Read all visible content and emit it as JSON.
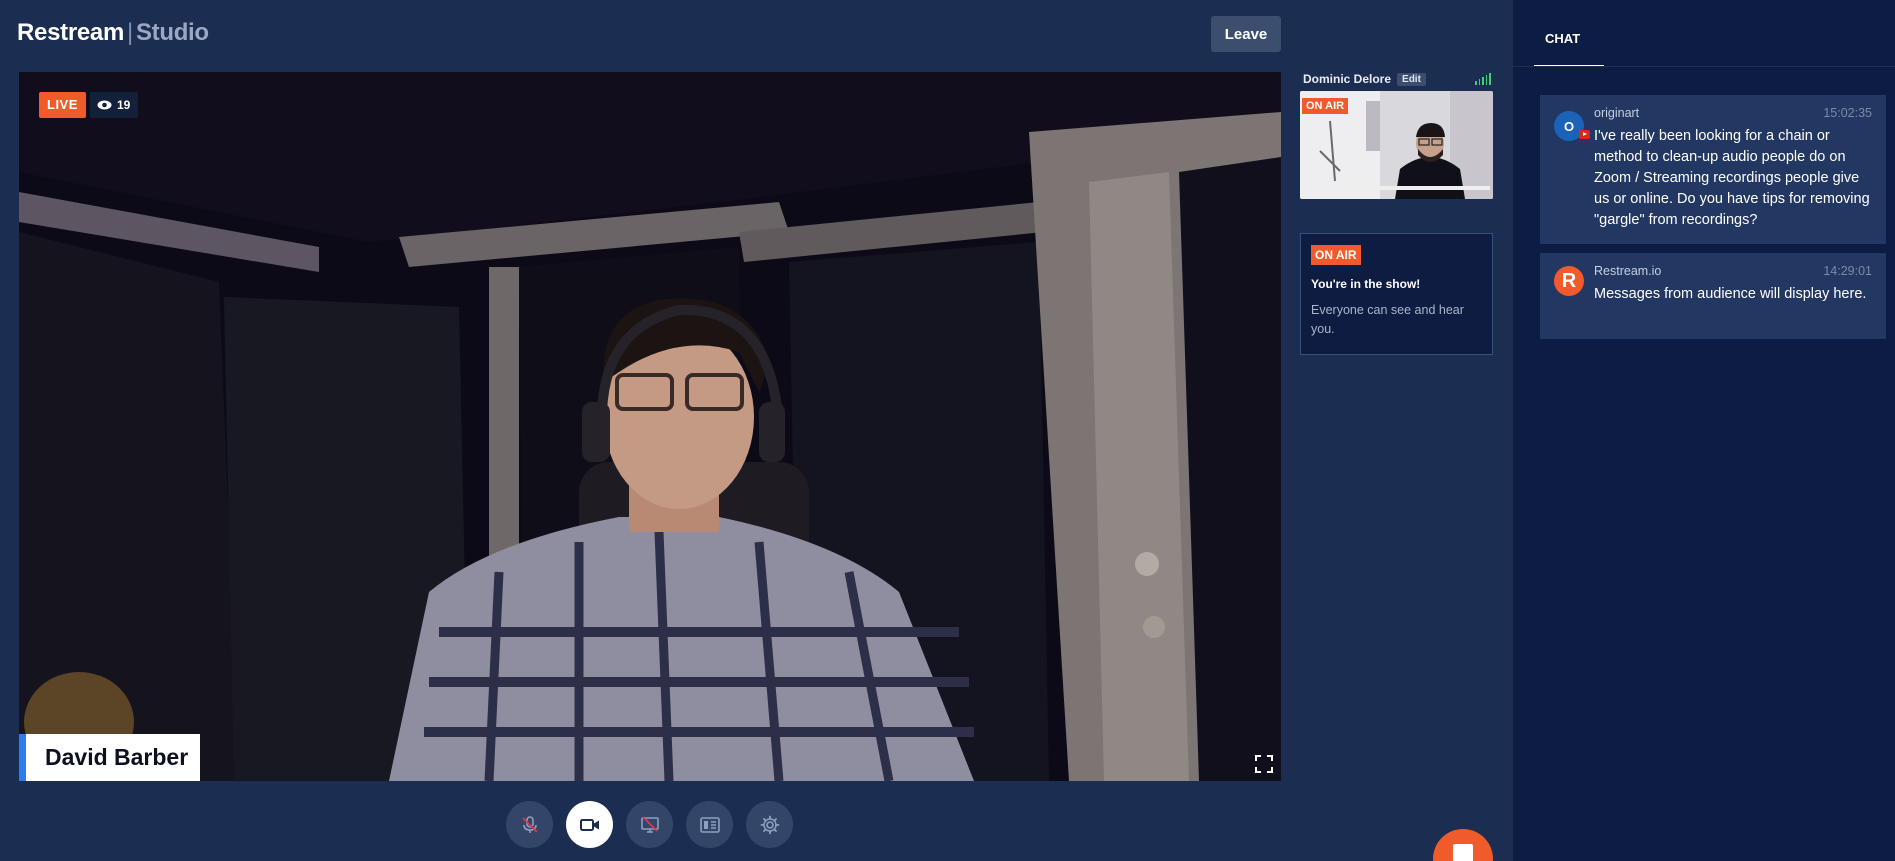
{
  "header": {
    "brand": "Restream",
    "separator": "|",
    "product": "Studio",
    "leave_label": "Leave"
  },
  "stage": {
    "live_label": "LIVE",
    "viewer_count": "19",
    "presenter_name": "David Barber"
  },
  "controls": [
    {
      "name": "mute-mic-button",
      "icon": "mic-off-icon"
    },
    {
      "name": "camera-button",
      "icon": "camera-icon",
      "active": true
    },
    {
      "name": "share-screen-button",
      "icon": "screen-share-off-icon"
    },
    {
      "name": "layout-button",
      "icon": "layout-icon"
    },
    {
      "name": "settings-button",
      "icon": "gear-icon"
    }
  ],
  "guest": {
    "name": "Dominic Delore",
    "edit_label": "Edit",
    "onair_label": "ON AIR"
  },
  "info": {
    "onair_label": "ON AIR",
    "title": "You're in the show!",
    "text": "Everyone can see and hear you."
  },
  "chat": {
    "tab_label": "CHAT",
    "messages": [
      {
        "avatar": "O",
        "author": "originart",
        "time": "15:02:35",
        "text": "I've really been looking for a chain or method to clean-up audio people do on Zoom / Streaming recordings people give us or online. Do you have tips for removing \"gargle\" from recordings?"
      },
      {
        "avatar": "R",
        "author": "Restream.io",
        "time": "14:29:01",
        "text": "Messages from audience will display here."
      }
    ]
  },
  "colors": {
    "background": "#1b2d50",
    "chat_background": "#0d1c43",
    "accent_orange": "#f15a2a",
    "accent_blue": "#2f7bf5"
  }
}
